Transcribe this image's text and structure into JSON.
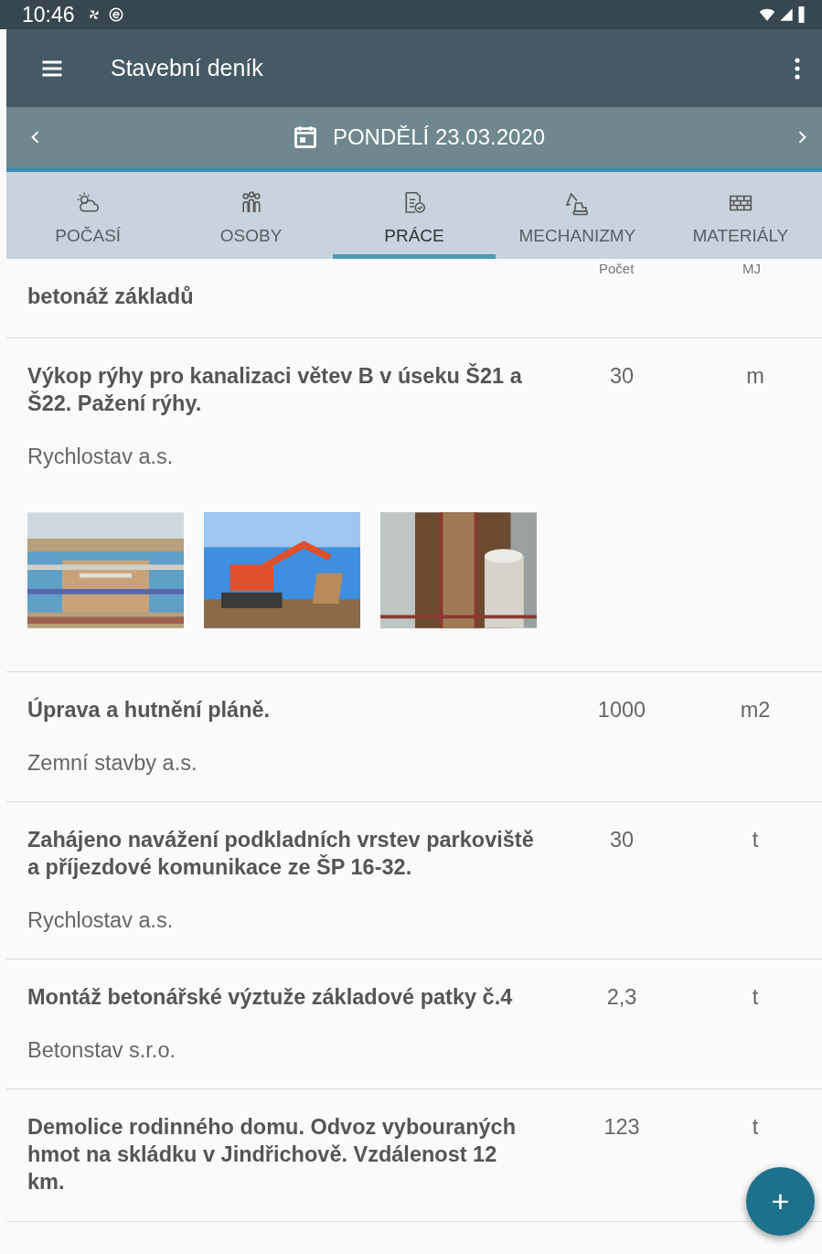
{
  "status_bar": {
    "time": "10:46"
  },
  "app_bar": {
    "title": "Stavební deník"
  },
  "date_bar": {
    "date": "PONDĚLÍ 23.03.2020"
  },
  "tabs": [
    {
      "label": "POČASÍ",
      "selected": false
    },
    {
      "label": "OSOBY",
      "selected": false
    },
    {
      "label": "PRÁCE",
      "selected": true
    },
    {
      "label": "MECHANIZMY",
      "selected": false
    },
    {
      "label": "MATERIÁLY",
      "selected": false
    }
  ],
  "columns": {
    "count": "Počet",
    "unit": "MJ"
  },
  "rows": [
    {
      "title": "betonáž základů"
    },
    {
      "title": "Výkop rýhy pro kanalizaci větev B v úseku Š21 a Š22. Pažení rýhy.",
      "company": "Rychlostav a.s.",
      "count": "30",
      "unit": "m"
    },
    {
      "title": "Úprava a hutnění pláně.",
      "company": "Zemní stavby a.s.",
      "count": "1000",
      "unit": "m2"
    },
    {
      "title": "Zahájeno navážení podkladních vrstev parkoviště a příjezdové komunikace ze ŠP 16-32.",
      "company": "Rychlostav a.s.",
      "count": "30",
      "unit": "t"
    },
    {
      "title": "Montáž betonářské výztuže základové patky č.4",
      "company": "Betonstav s.r.o.",
      "count": "2,3",
      "unit": "t"
    },
    {
      "title": "Demolice rodinného domu. Odvoz vybouraných hmot na skládku v Jindřichově. Vzdálenost 12 km.",
      "count": "123",
      "unit": "t"
    }
  ],
  "fab": {
    "label": "+"
  }
}
